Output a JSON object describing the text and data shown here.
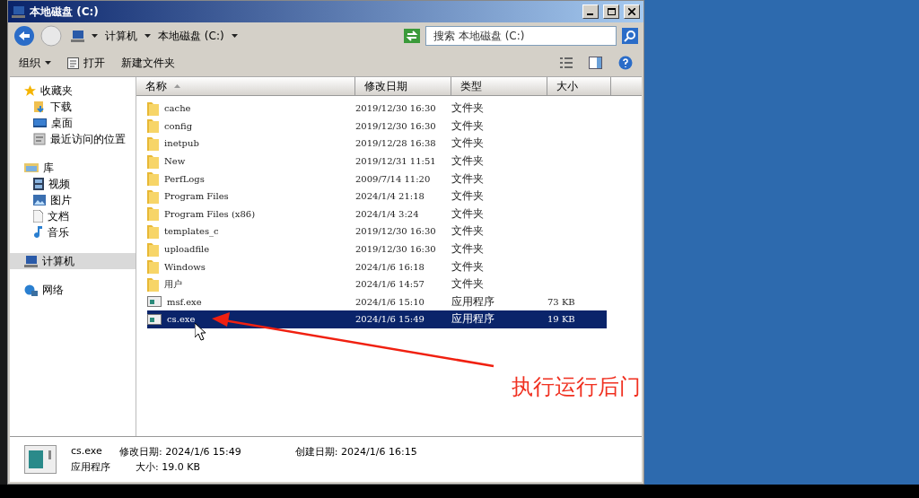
{
  "window": {
    "title": "本地磁盘 (C:)"
  },
  "address": {
    "crumbs": [
      "计算机",
      "本地磁盘 (C:)"
    ]
  },
  "search": {
    "placeholder": "搜索 本地磁盘 (C:)"
  },
  "toolbar": [
    {
      "label": "组织",
      "dropdown": true,
      "kind": "plain"
    },
    {
      "label": "打开",
      "dropdown": false,
      "kind": "open"
    },
    {
      "label": "新建文件夹",
      "dropdown": false,
      "kind": "plain"
    }
  ],
  "sidebar": [
    {
      "label": "收藏夹",
      "kind": "star",
      "selected": false,
      "children": [
        {
          "label": "下载",
          "kind": "download",
          "selected": false
        },
        {
          "label": "桌面",
          "kind": "desktop",
          "selected": false
        },
        {
          "label": "最近访问的位置",
          "kind": "recent",
          "selected": false
        }
      ]
    },
    {
      "label": "库",
      "kind": "library",
      "selected": false,
      "children": [
        {
          "label": "视频",
          "kind": "video",
          "selected": false
        },
        {
          "label": "图片",
          "kind": "picture",
          "selected": false
        },
        {
          "label": "文档",
          "kind": "document",
          "selected": false
        },
        {
          "label": "音乐",
          "kind": "music",
          "selected": false
        }
      ]
    },
    {
      "label": "计算机",
      "kind": "computer",
      "selected": true
    },
    {
      "label": "网络",
      "kind": "network",
      "selected": false
    }
  ],
  "table": {
    "columns": [
      "名称",
      "修改日期",
      "类型",
      "大小"
    ],
    "rows": [
      {
        "name": "cache",
        "date": "2019/12/30 16:30",
        "type": "文件夹",
        "kind": "folder",
        "selected": false
      },
      {
        "name": "config",
        "date": "2019/12/30 16:30",
        "type": "文件夹",
        "kind": "folder",
        "selected": false
      },
      {
        "name": "inetpub",
        "date": "2019/12/28 16:38",
        "type": "文件夹",
        "kind": "folder",
        "selected": false
      },
      {
        "name": "New",
        "date": "2019/12/31 11:51",
        "type": "文件夹",
        "kind": "folder",
        "selected": false
      },
      {
        "name": "PerfLogs",
        "date": "2009/7/14 11:20",
        "type": "文件夹",
        "kind": "folder",
        "selected": false
      },
      {
        "name": "Program Files",
        "date": "2024/1/4 21:18",
        "type": "文件夹",
        "kind": "folder",
        "selected": false
      },
      {
        "name": "Program Files (x86)",
        "date": "2024/1/4 3:24",
        "type": "文件夹",
        "kind": "folder",
        "selected": false
      },
      {
        "name": "templates_c",
        "date": "2019/12/30 16:30",
        "type": "文件夹",
        "kind": "folder",
        "selected": false
      },
      {
        "name": "uploadfile",
        "date": "2019/12/30 16:30",
        "type": "文件夹",
        "kind": "folder",
        "selected": false
      },
      {
        "name": "Windows",
        "date": "2024/1/6 16:18",
        "type": "文件夹",
        "kind": "folder",
        "selected": false
      },
      {
        "name": "用户",
        "date": "2024/1/6 14:57",
        "type": "文件夹",
        "kind": "folder",
        "selected": false
      },
      {
        "name": "msf.exe",
        "date": "2024/1/6 15:10",
        "type": "应用程序",
        "size": "73 KB",
        "kind": "program",
        "selected": false
      },
      {
        "name": "cs.exe",
        "date": "2024/1/6 15:49",
        "type": "应用程序",
        "size": "19 KB",
        "kind": "program",
        "selected": true
      }
    ]
  },
  "details": {
    "name": "cs.exe",
    "type": "应用程序",
    "modified_label": "修改日期:",
    "modified": "2024/1/6 15:49",
    "size_label": "大小:",
    "size": "19.0 KB",
    "created_label": "创建日期:",
    "created": "2024/1/6 16:15"
  },
  "annotation": {
    "text": "执行运行后门"
  }
}
